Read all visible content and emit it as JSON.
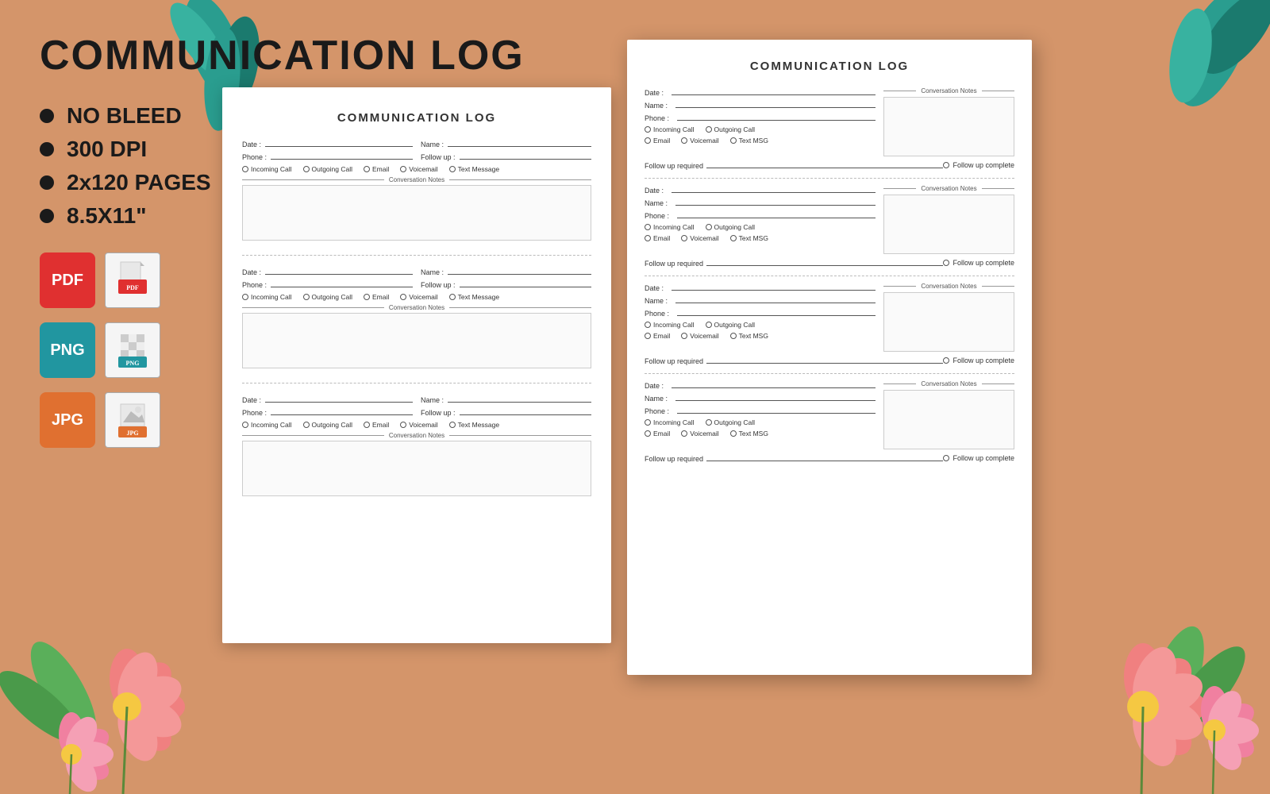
{
  "page": {
    "title": "COMMUNICATION LOG",
    "background_color": "#d4956a"
  },
  "left": {
    "main_title": "COMMUNICATION LOG",
    "features": [
      "NO BLEED",
      "300 DPI",
      "2x120 PAGES",
      "8.5X11\""
    ],
    "formats": [
      "PDF",
      "PNG",
      "JPG"
    ]
  },
  "paper_back": {
    "title": "COMMUNICATION LOG",
    "entries": [
      {
        "date_label": "Date :",
        "name_label": "Name :",
        "phone_label": "Phone :",
        "followup_label": "Follow up :",
        "radio_options": [
          "Incoming Call",
          "Outgoing Call",
          "Email",
          "Voicemail",
          "Text Message"
        ],
        "conv_notes_label": "Conversation Notes"
      },
      {
        "date_label": "Date :",
        "name_label": "Name :",
        "phone_label": "Phone :",
        "followup_label": "Follow up :",
        "radio_options": [
          "Incoming Call",
          "Outgoing Call",
          "Email",
          "Voicemail",
          "Text Message"
        ],
        "conv_notes_label": "Conversation Notes"
      },
      {
        "date_label": "Date :",
        "name_label": "Name :",
        "phone_label": "Phone :",
        "followup_label": "Follow up :",
        "radio_options": [
          "Incoming Call",
          "Outgoing Call",
          "Email",
          "Voicemail",
          "Text Message"
        ],
        "conv_notes_label": "Conversation Notes"
      }
    ]
  },
  "paper_front": {
    "title": "COMMUNICATION LOG",
    "entries": [
      {
        "date_label": "Date :",
        "name_label": "Name :",
        "phone_label": "Phone :",
        "radio_row1": [
          "Incoming Call",
          "Outgoing Call"
        ],
        "radio_row2": [
          "Email",
          "Voicemail",
          "Text MSG"
        ],
        "followup_required_label": "Follow up required",
        "followup_complete_label": "Follow up complete",
        "conv_notes_label": "Conversation Notes"
      },
      {
        "date_label": "Date :",
        "name_label": "Name :",
        "phone_label": "Phone :",
        "radio_row1": [
          "Incoming Call",
          "Outgoing Call"
        ],
        "radio_row2": [
          "Email",
          "Voicemail",
          "Text MSG"
        ],
        "followup_required_label": "Follow up required",
        "followup_complete_label": "Follow up complete",
        "conv_notes_label": "Conversation Notes"
      },
      {
        "date_label": "Date :",
        "name_label": "Name :",
        "phone_label": "Phone :",
        "radio_row1": [
          "Incoming Call",
          "Outgoing Call"
        ],
        "radio_row2": [
          "Email",
          "Voicemail",
          "Text MSG"
        ],
        "followup_required_label": "Follow up required",
        "followup_complete_label": "Follow up complete",
        "conv_notes_label": "Conversation Notes"
      },
      {
        "date_label": "Date :",
        "name_label": "Name :",
        "phone_label": "Phone :",
        "radio_row1": [
          "Incoming Call",
          "Outgoing Call"
        ],
        "radio_row2": [
          "Email",
          "Voicemail",
          "Text MSG"
        ],
        "followup_required_label": "Follow up required",
        "followup_complete_label": "Follow up complete",
        "conv_notes_label": "Conversation Notes"
      }
    ]
  }
}
